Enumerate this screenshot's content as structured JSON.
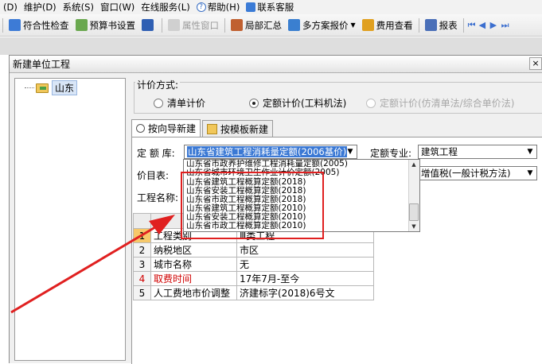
{
  "menubar": [
    {
      "label": "(D)"
    },
    {
      "label": "维护(D)"
    },
    {
      "label": "系统(S)"
    },
    {
      "label": "窗口(W)"
    },
    {
      "label": "在线服务(L)"
    },
    {
      "label": "帮助(H)",
      "icon": "help-icon"
    },
    {
      "label": "联系客服",
      "icon": "contact-icon"
    }
  ],
  "toolbar": {
    "items": [
      {
        "label": "符合性检查",
        "icon": "check-list-icon",
        "color": "#3d7bd6"
      },
      {
        "label": "预算书设置",
        "icon": "settings-icon",
        "color": "#6aa84f"
      },
      {
        "label": "",
        "icon": "sort-icon",
        "color": "#2f5fb3"
      },
      {
        "label": "属性窗口",
        "icon": "properties-icon",
        "color": "#c8c8c8",
        "disabled": true
      },
      {
        "label": "局部汇总",
        "icon": "summary-icon",
        "color": "#c06030"
      },
      {
        "label": "多方案报价",
        "icon": "multi-quote-icon",
        "color": "#3a7fd0"
      },
      {
        "label": "费用查看",
        "icon": "fee-view-icon",
        "color": "#e0a020"
      },
      {
        "label": "报表",
        "icon": "report-icon",
        "color": "#4a6fb8"
      }
    ],
    "nav": [
      "⏮",
      "◀",
      "▶",
      "⏭"
    ]
  },
  "dialog": {
    "title": "新建单位工程",
    "close": "×",
    "tree_root": "山东",
    "pricing_method_label": "计价方式:",
    "radios": [
      {
        "label": "清单计价",
        "selected": false,
        "disabled": false
      },
      {
        "label": "定额计价(工料机法)",
        "selected": true,
        "disabled": false
      },
      {
        "label": "定额计价(仿清单法/综合单价法)",
        "selected": false,
        "disabled": true
      }
    ],
    "tabs": [
      {
        "label": "按向导新建",
        "active": true
      },
      {
        "label": "按模板新建",
        "active": false
      }
    ],
    "form": {
      "quota_lib_label": "定 额 库:",
      "quota_lib_value": "山东省建筑工程消耗量定额(2006基价)",
      "quota_major_label": "定额专业:",
      "quota_major_value": "建筑工程",
      "price_list_label": "价目表:",
      "tax_value": "增值税(一般计税方法)",
      "project_name_label": "工程名称:"
    },
    "dropdown_items": [
      "山东省市政养护维修工程消耗量定额(2005)",
      "山东省城市环境卫生作业计价定额(2005)",
      "山东省建筑工程概算定额(2018)",
      "山东省安装工程概算定额(2018)",
      "山东省市政工程概算定额(2018)",
      "山东省建筑工程概算定额(2010)",
      "山东省安装工程概算定额(2010)",
      "山东省市政工程概算定额(2010)"
    ],
    "grid_rows": [
      {
        "num": "1",
        "name": "工程类别",
        "value": "Ⅲ类工程",
        "red": false
      },
      {
        "num": "2",
        "name": "纳税地区",
        "value": "市区",
        "red": false
      },
      {
        "num": "3",
        "name": "城市名称",
        "value": "无",
        "red": false
      },
      {
        "num": "4",
        "name": "取费时间",
        "value": "17年7月-至今",
        "red": true
      },
      {
        "num": "5",
        "name": "人工费地市价调整",
        "value": "济建标字(2018)6号文",
        "red": false
      }
    ]
  },
  "annotation_color": "#e02020"
}
